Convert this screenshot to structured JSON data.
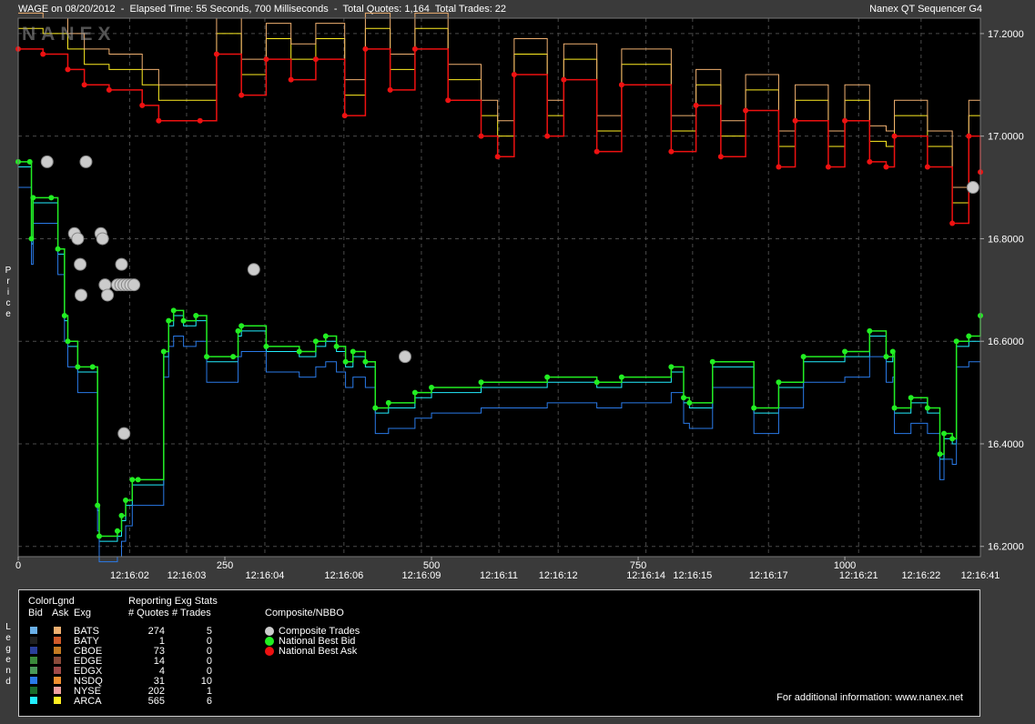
{
  "header": {
    "left": "WAGE on 08/20/2012  -  Elapsed Time: 55 Seconds, 700 Milliseconds  -  Total Quotes: 1,164  Total Trades: 22",
    "right": "Nanex QT Sequencer G4"
  },
  "watermark": "NANEX",
  "side_labels": {
    "price": "Price",
    "legend": "Legend"
  },
  "colors": {
    "background": "#000000",
    "grid": "#4a4a4a",
    "nbb": "#22ee22",
    "nba": "#ee1111",
    "trade": "#cccccc",
    "arca_ask": "#ffee22",
    "arca_bid": "#22eeff"
  },
  "chart_data": {
    "type": "line",
    "y_label": "Price",
    "ylim": [
      16.18,
      17.23
    ],
    "xlim": [
      0,
      1164
    ],
    "y_ticks": [
      "17.2000",
      "17.0000",
      "16.8000",
      "16.6000",
      "16.4000",
      "16.2000"
    ],
    "y_tick_values": [
      17.2,
      17.0,
      16.8,
      16.6,
      16.4,
      16.2
    ],
    "x_ticks_seq": [
      {
        "x": 0,
        "label": "0"
      },
      {
        "x": 250,
        "label": "250"
      },
      {
        "x": 500,
        "label": "500"
      },
      {
        "x": 750,
        "label": "750"
      },
      {
        "x": 1000,
        "label": "1000"
      }
    ],
    "x_ticks_time": [
      {
        "x": 164,
        "label": "12:16:02"
      },
      {
        "x": 236,
        "label": "12:16:03"
      },
      {
        "x": 335,
        "label": "12:16:04"
      },
      {
        "x": 435,
        "label": "12:16:06"
      },
      {
        "x": 533,
        "label": "12:16:09"
      },
      {
        "x": 631,
        "label": "12:16:11"
      },
      {
        "x": 706,
        "label": "12:16:12"
      },
      {
        "x": 817,
        "label": "12:16:14"
      },
      {
        "x": 876,
        "label": "12:16:15"
      },
      {
        "x": 972,
        "label": "12:16:17"
      },
      {
        "x": 1086,
        "label": "12:16:21"
      },
      {
        "x": 1165,
        "label": "12:16:22"
      },
      {
        "x": 1240,
        "label": "12:16:41"
      }
    ],
    "series": [
      {
        "name": "National Best Bid",
        "points": [
          [
            0,
            16.95
          ],
          [
            14,
            16.95
          ],
          [
            16,
            16.8
          ],
          [
            18,
            16.88
          ],
          [
            40,
            16.88
          ],
          [
            48,
            16.78
          ],
          [
            56,
            16.65
          ],
          [
            60,
            16.6
          ],
          [
            72,
            16.55
          ],
          [
            90,
            16.55
          ],
          [
            96,
            16.28
          ],
          [
            98,
            16.22
          ],
          [
            120,
            16.23
          ],
          [
            125,
            16.26
          ],
          [
            130,
            16.29
          ],
          [
            138,
            16.33
          ],
          [
            145,
            16.33
          ],
          [
            176,
            16.58
          ],
          [
            182,
            16.64
          ],
          [
            188,
            16.66
          ],
          [
            200,
            16.64
          ],
          [
            215,
            16.65
          ],
          [
            228,
            16.57
          ],
          [
            260,
            16.57
          ],
          [
            266,
            16.62
          ],
          [
            270,
            16.63
          ],
          [
            300,
            16.59
          ],
          [
            340,
            16.58
          ],
          [
            360,
            16.6
          ],
          [
            372,
            16.61
          ],
          [
            385,
            16.59
          ],
          [
            396,
            16.56
          ],
          [
            405,
            16.58
          ],
          [
            420,
            16.56
          ],
          [
            432,
            16.47
          ],
          [
            448,
            16.48
          ],
          [
            480,
            16.5
          ],
          [
            500,
            16.51
          ],
          [
            560,
            16.52
          ],
          [
            640,
            16.53
          ],
          [
            700,
            16.52
          ],
          [
            730,
            16.53
          ],
          [
            790,
            16.55
          ],
          [
            805,
            16.49
          ],
          [
            812,
            16.48
          ],
          [
            840,
            16.56
          ],
          [
            890,
            16.47
          ],
          [
            920,
            16.52
          ],
          [
            950,
            16.57
          ],
          [
            1000,
            16.58
          ],
          [
            1030,
            16.62
          ],
          [
            1050,
            16.57
          ],
          [
            1058,
            16.58
          ],
          [
            1060,
            16.47
          ],
          [
            1080,
            16.49
          ],
          [
            1100,
            16.47
          ],
          [
            1115,
            16.38
          ],
          [
            1120,
            16.42
          ],
          [
            1130,
            16.41
          ],
          [
            1135,
            16.6
          ],
          [
            1150,
            16.61
          ],
          [
            1164,
            16.65
          ]
        ]
      },
      {
        "name": "National Best Ask",
        "points": [
          [
            0,
            17.17
          ],
          [
            30,
            17.16
          ],
          [
            60,
            17.13
          ],
          [
            80,
            17.1
          ],
          [
            110,
            17.09
          ],
          [
            150,
            17.06
          ],
          [
            170,
            17.03
          ],
          [
            220,
            17.03
          ],
          [
            240,
            17.16
          ],
          [
            270,
            17.08
          ],
          [
            300,
            17.15
          ],
          [
            330,
            17.11
          ],
          [
            360,
            17.15
          ],
          [
            395,
            17.04
          ],
          [
            420,
            17.17
          ],
          [
            450,
            17.09
          ],
          [
            480,
            17.17
          ],
          [
            520,
            17.07
          ],
          [
            560,
            17.0
          ],
          [
            580,
            16.96
          ],
          [
            600,
            17.12
          ],
          [
            640,
            17.0
          ],
          [
            660,
            17.11
          ],
          [
            700,
            16.97
          ],
          [
            730,
            17.1
          ],
          [
            790,
            16.97
          ],
          [
            820,
            17.06
          ],
          [
            850,
            16.96
          ],
          [
            880,
            17.05
          ],
          [
            920,
            16.94
          ],
          [
            940,
            17.03
          ],
          [
            980,
            16.94
          ],
          [
            1000,
            17.03
          ],
          [
            1030,
            16.95
          ],
          [
            1050,
            16.94
          ],
          [
            1060,
            17.0
          ],
          [
            1100,
            16.94
          ],
          [
            1130,
            16.83
          ],
          [
            1150,
            17.0
          ],
          [
            1164,
            16.93
          ]
        ]
      },
      {
        "name": "Composite Trades",
        "points": [
          [
            35,
            16.95
          ],
          [
            82,
            16.95
          ],
          [
            68,
            16.81
          ],
          [
            72,
            16.8
          ],
          [
            100,
            16.81
          ],
          [
            102,
            16.8
          ],
          [
            75,
            16.75
          ],
          [
            76,
            16.69
          ],
          [
            105,
            16.71
          ],
          [
            108,
            16.69
          ],
          [
            120,
            16.71
          ],
          [
            124,
            16.71
          ],
          [
            128,
            16.71
          ],
          [
            132,
            16.71
          ],
          [
            136,
            16.71
          ],
          [
            140,
            16.71
          ],
          [
            125,
            16.75
          ],
          [
            128,
            16.42
          ],
          [
            285,
            16.74
          ],
          [
            468,
            16.57
          ],
          [
            1155,
            16.9
          ]
        ]
      }
    ]
  },
  "legend": {
    "color_legend_label": "ColorLgnd",
    "col_bid": "Bid",
    "col_ask": "Ask",
    "col_exg": "Exg",
    "stats_title": "Reporting Exg Stats",
    "col_quotes": "# Quotes",
    "col_trades": "# Trades",
    "composite_title": "Composite/NBBO",
    "rows": [
      {
        "exg": "BATS",
        "quotes": "274",
        "trades": "5",
        "bid": "#6ab0e8",
        "ask": "#f0b070"
      },
      {
        "exg": "BATY",
        "quotes": "1",
        "trades": "0",
        "bid": "#202020",
        "ask": "#d05a2a"
      },
      {
        "exg": "CBOE",
        "quotes": "73",
        "trades": "0",
        "bid": "#2a3f9a",
        "ask": "#c47a22"
      },
      {
        "exg": "EDGE",
        "quotes": "14",
        "trades": "0",
        "bid": "#3a8a3a",
        "ask": "#8a4a3a"
      },
      {
        "exg": "EDGX",
        "quotes": "4",
        "trades": "0",
        "bid": "#4a9a5a",
        "ask": "#a04a4a"
      },
      {
        "exg": "NSDQ",
        "quotes": "31",
        "trades": "10",
        "bid": "#2a7ae8",
        "ask": "#f09030"
      },
      {
        "exg": "NYSE",
        "quotes": "202",
        "trades": "1",
        "bid": "#1a6a2a",
        "ask": "#f0a0a0"
      },
      {
        "exg": "ARCA",
        "quotes": "565",
        "trades": "6",
        "bid": "#22eeff",
        "ask": "#ffee22"
      }
    ],
    "composite_items": [
      {
        "label": "Composite Trades",
        "color": "#cccccc"
      },
      {
        "label": "National Best Bid",
        "color": "#22ee22"
      },
      {
        "label": "National Best Ask",
        "color": "#ee1111"
      }
    ],
    "footer": "For additional information: www.nanex.net"
  }
}
